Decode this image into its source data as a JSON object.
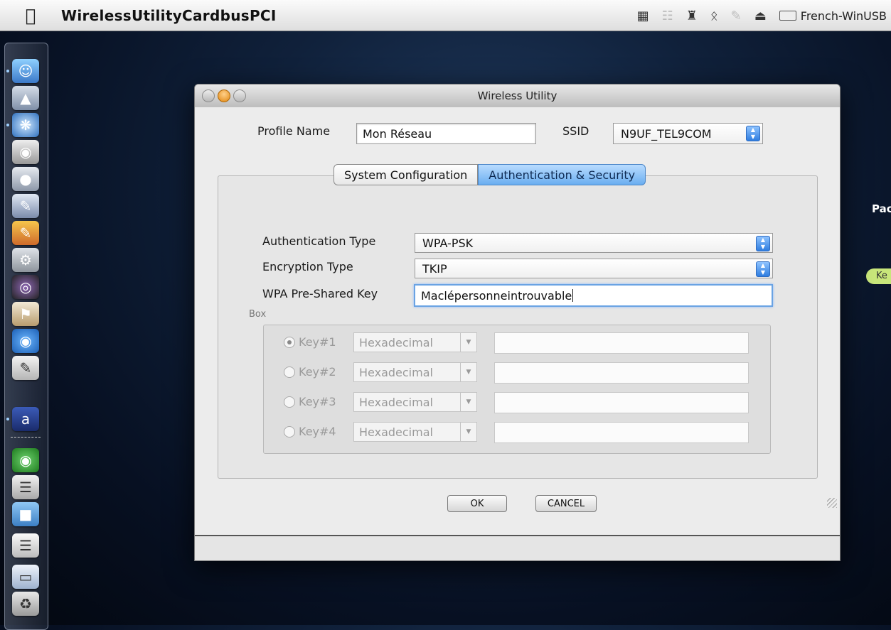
{
  "menubar": {
    "apple": "",
    "app_name": "WirelessUtilityCardbusPCI",
    "status_icons": [
      "image-capture-icon",
      "network-activity-icon",
      "binoculars-icon",
      "bluetooth-icon",
      "eject-icon"
    ],
    "input_menu": "French-WinUSB"
  },
  "background": {
    "fragment_label": "Pac",
    "fragment_pill": "Ke"
  },
  "window": {
    "title": "Wireless Utility",
    "profile_name_label": "Profile Name",
    "profile_name_value": "Mon Réseau",
    "ssid_label": "SSID",
    "ssid_value": "N9UF_TEL9COM",
    "tabs": [
      {
        "label": "System Configuration",
        "active": false
      },
      {
        "label": "Authentication & Security",
        "active": true
      }
    ],
    "auth_type_label": "Authentication Type",
    "auth_type_value": "WPA-PSK",
    "enc_type_label": "Encryption Type",
    "enc_type_value": "TKIP",
    "psk_label": "WPA Pre-Shared Key",
    "psk_value": "Maclépersonneintrouvable",
    "box_label": "Box",
    "keys": [
      {
        "label": "Key#1",
        "format": "Hexadecimal",
        "selected": true
      },
      {
        "label": "Key#2",
        "format": "Hexadecimal",
        "selected": false
      },
      {
        "label": "Key#3",
        "format": "Hexadecimal",
        "selected": false
      },
      {
        "label": "Key#4",
        "format": "Hexadecimal",
        "selected": false
      }
    ],
    "ok_label": "OK",
    "cancel_label": "CANCEL"
  }
}
